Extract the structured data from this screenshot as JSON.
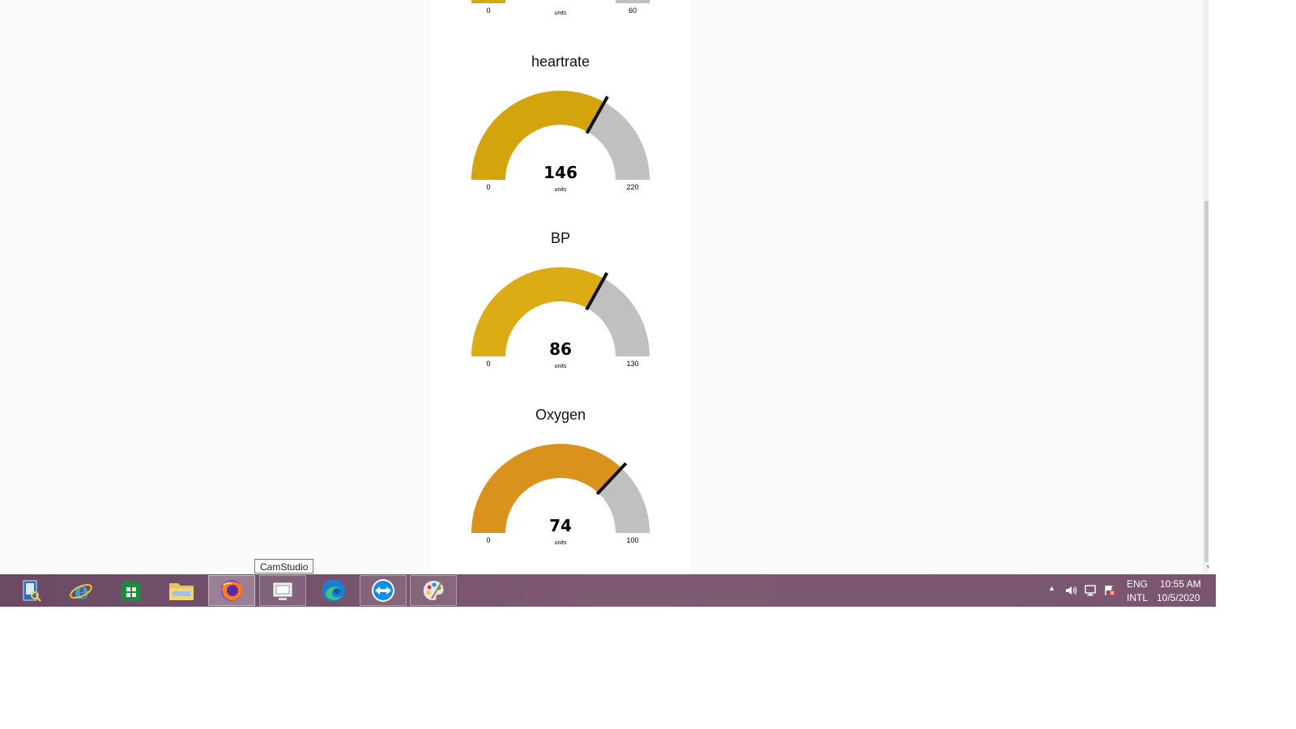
{
  "gauges": [
    {
      "title": "",
      "value": "",
      "units": "units",
      "min": "0",
      "max": "60",
      "min_num": 0,
      "max_num": 60,
      "value_num": 12,
      "color": "#d4a80f"
    },
    {
      "title": "heartrate",
      "value": "146",
      "units": "units",
      "min": "0",
      "max": "220",
      "min_num": 0,
      "max_num": 220,
      "value_num": 146,
      "color": "#d4a40c"
    },
    {
      "title": "BP",
      "value": "86",
      "units": "units",
      "min": "0",
      "max": "130",
      "min_num": 0,
      "max_num": 130,
      "value_num": 86,
      "color": "#dcac14"
    },
    {
      "title": "Oxygen",
      "value": "74",
      "units": "units",
      "min": "0",
      "max": "100",
      "min_num": 0,
      "max_num": 100,
      "value_num": 74,
      "color": "#d9921c"
    }
  ],
  "taskbar": {
    "tooltip": "CamStudio",
    "apps": [
      {
        "name": "search-app"
      },
      {
        "name": "internet-explorer"
      },
      {
        "name": "store"
      },
      {
        "name": "file-explorer"
      },
      {
        "name": "firefox"
      },
      {
        "name": "camstudio"
      },
      {
        "name": "edge"
      },
      {
        "name": "teamviewer"
      },
      {
        "name": "paint"
      }
    ],
    "language_top": "ENG",
    "language_bottom": "INTL",
    "time": "10:55 AM",
    "date": "10/5/2020"
  },
  "colors": {
    "track": "#c0c0c0",
    "needle": "#111111",
    "taskbar": "#7a5570"
  }
}
